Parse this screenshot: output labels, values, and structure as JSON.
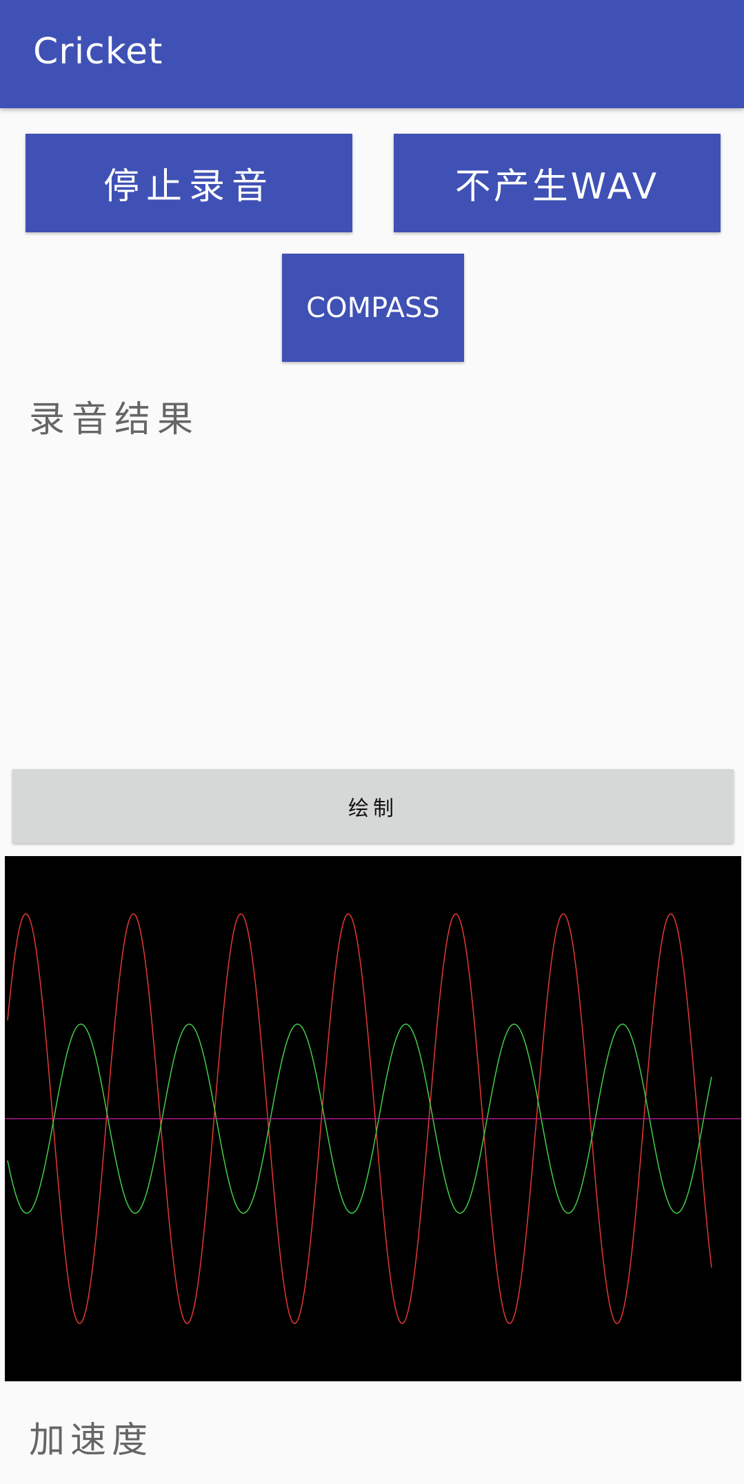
{
  "app_bar": {
    "title": "Cricket",
    "color": "#3f51b5"
  },
  "buttons": {
    "stop_recording": "停止录音",
    "no_wav": "不产生WAV",
    "compass": "COMPASS",
    "draw": "绘制"
  },
  "labels": {
    "recording_result": "录音结果",
    "acceleration": "加速度"
  },
  "chart_data": {
    "type": "line",
    "background": "#000000",
    "series": [
      {
        "color": "#e53935",
        "description_values": "red sinusoid, larger amplitude",
        "amplitude": 0.78,
        "cycles": 6.55,
        "phase": 0.5
      },
      {
        "color": "#43d04a",
        "amplitude": 0.36,
        "cycles": 6.5,
        "phase": 3.6
      },
      {
        "color": "#b0188f",
        "amplitude": 0,
        "cycles": 0,
        "phase": 0
      }
    ]
  }
}
